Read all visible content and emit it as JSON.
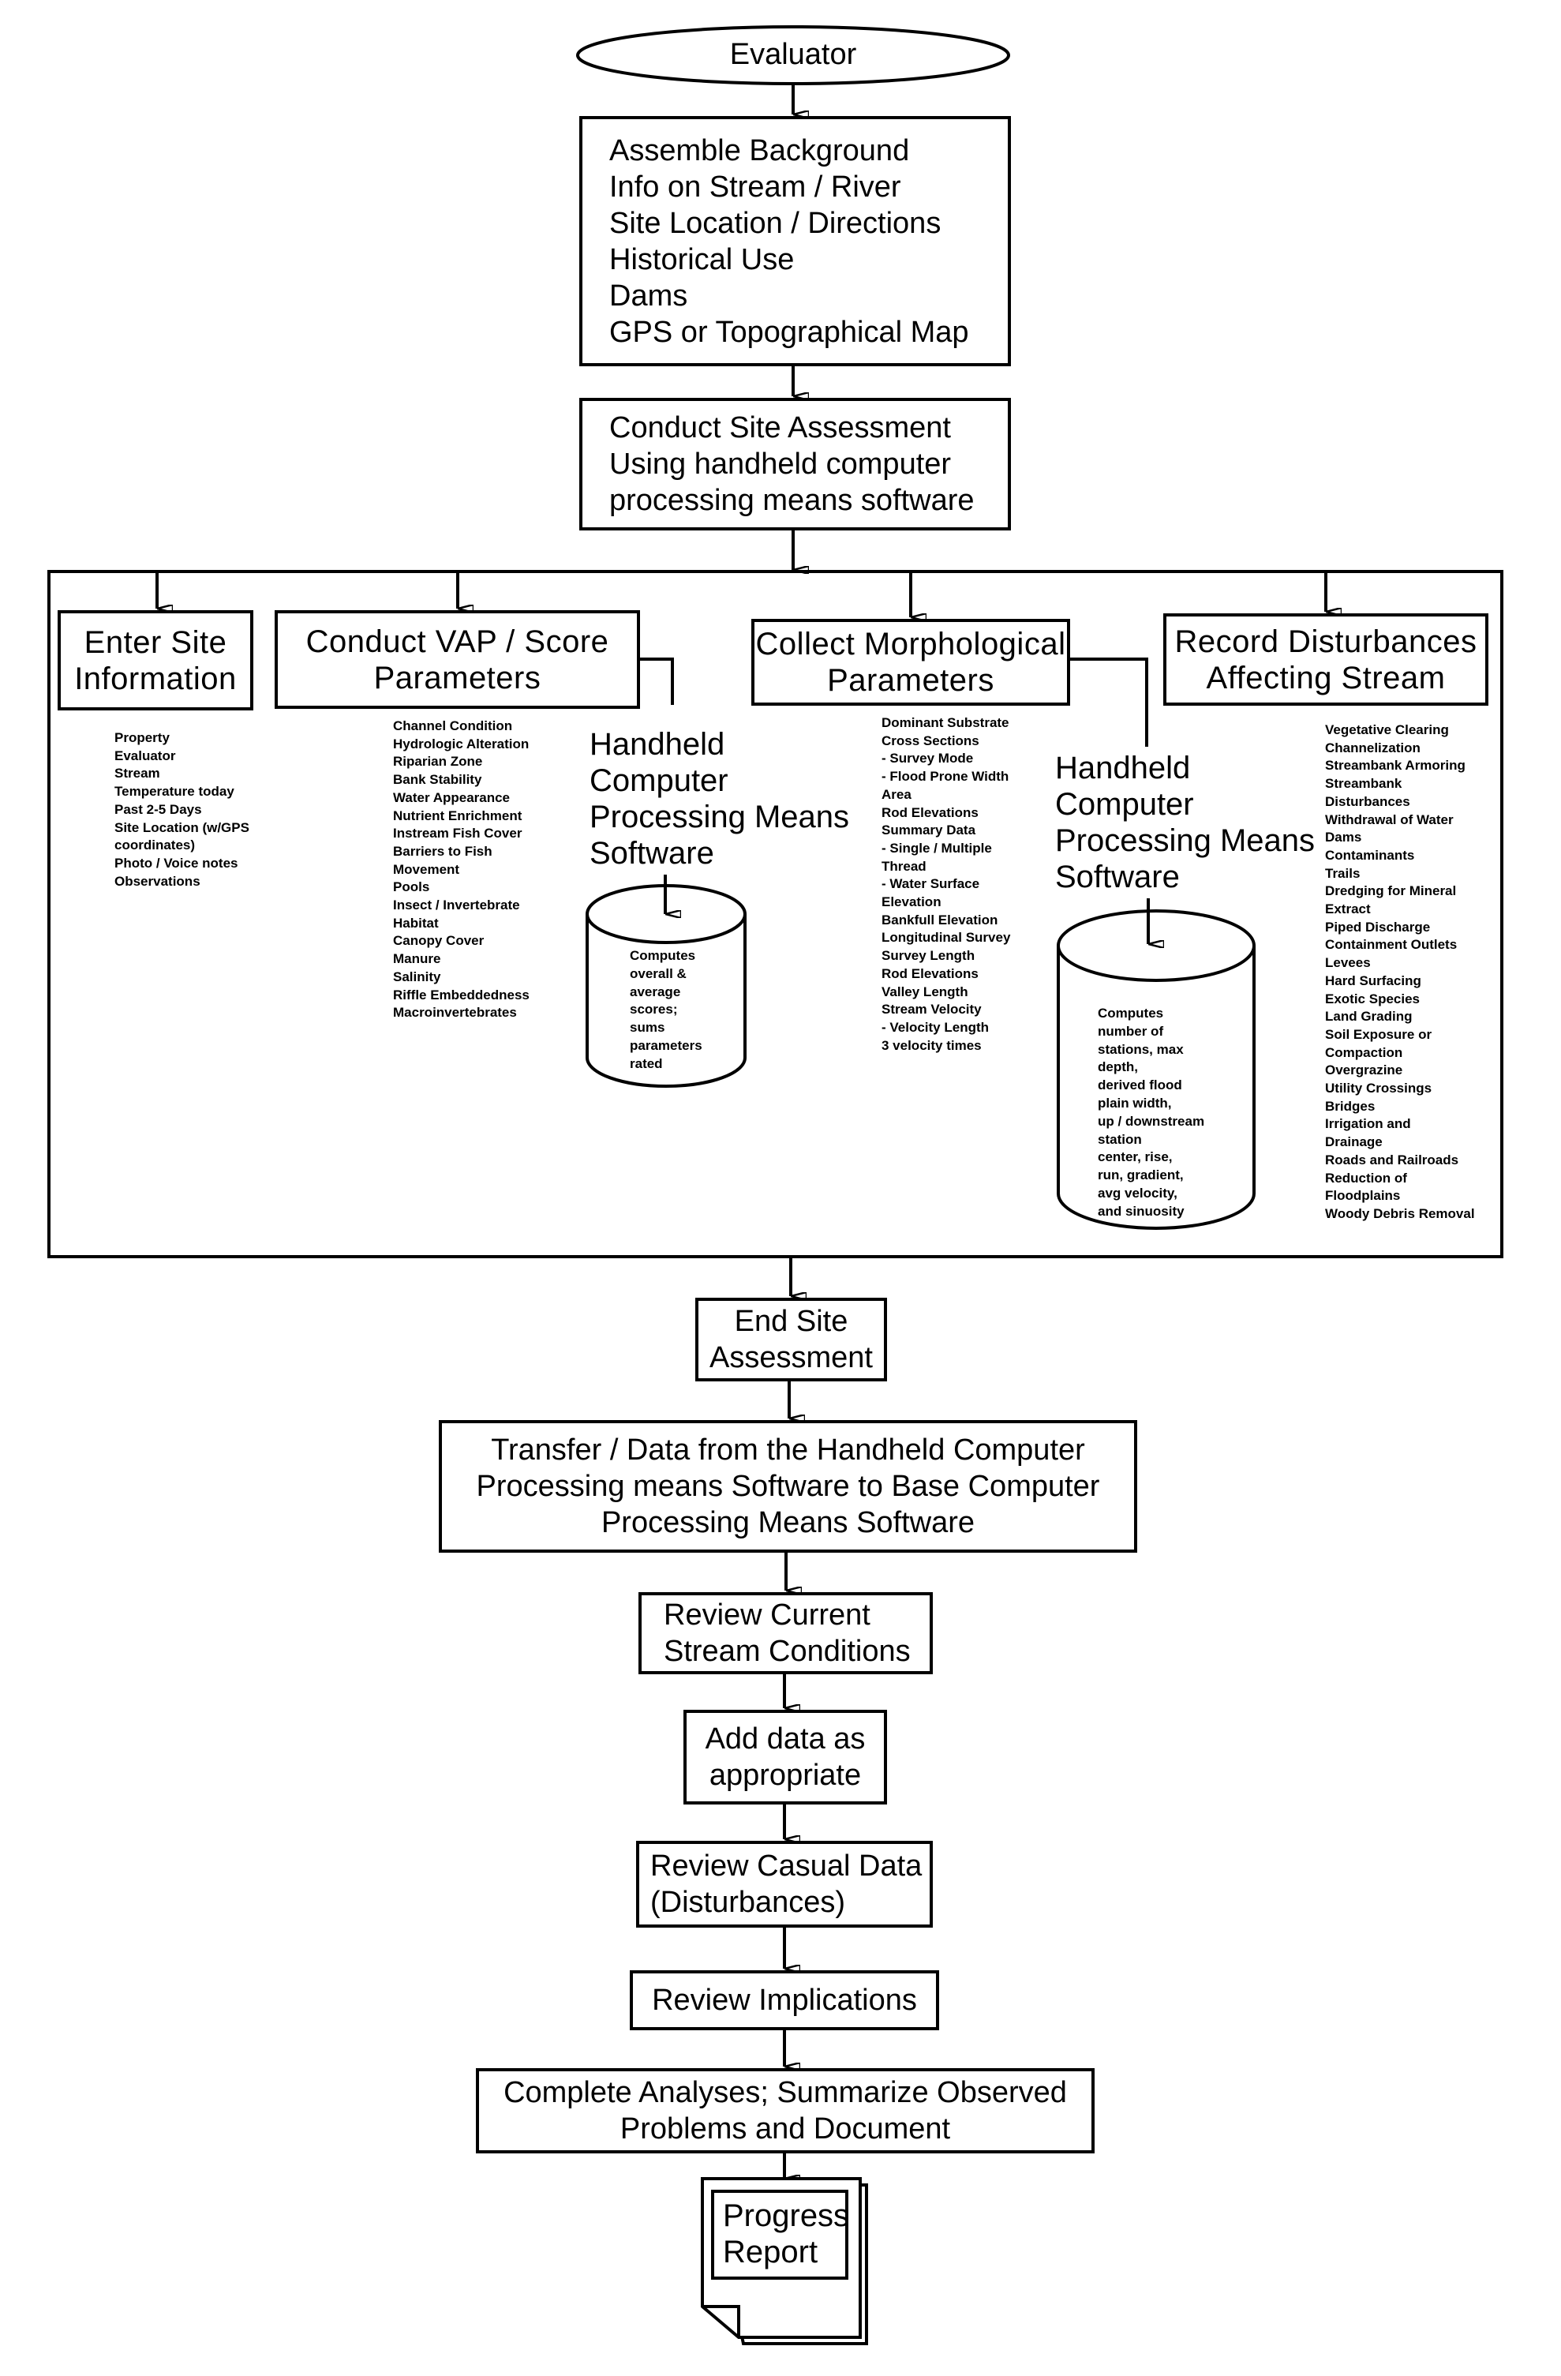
{
  "flowchart": {
    "start": {
      "label": "Evaluator"
    },
    "assemble": {
      "lines": [
        "Assemble Background",
        "Info on Stream / River",
        "Site Location / Directions",
        "Historical Use",
        "Dams",
        "GPS or Topographical Map"
      ]
    },
    "conduct": {
      "lines": [
        "Conduct Site Assessment",
        "Using handheld computer",
        "processing means software"
      ]
    },
    "site_assessment_group": {
      "enter_site": {
        "title": [
          "Enter Site",
          "Information"
        ],
        "items": [
          "Property",
          "Evaluator",
          "Stream",
          "Temperature today",
          "Past 2-5 Days",
          "Site Location (w/GPS",
          "coordinates)",
          "Photo / Voice notes",
          "Observations"
        ]
      },
      "vap": {
        "title": [
          "Conduct VAP / Score",
          "Parameters"
        ],
        "items": [
          "Channel Condition",
          "Hydrologic Alteration",
          "Riparian Zone",
          "Bank Stability",
          "Water Appearance",
          "Nutrient Enrichment",
          "Instream Fish Cover",
          "Barriers to Fish",
          "Movement",
          "Pools",
          "Insect / Invertebrate",
          "Habitat",
          "Canopy Cover",
          "Manure",
          "Salinity",
          "Riffle Embeddedness",
          "Macroinvertebrates"
        ],
        "software_label": [
          "Handheld",
          "Computer",
          "Processing Means",
          "Software"
        ],
        "database_text": [
          "Computes",
          "overall &",
          "average",
          "scores;",
          "sums",
          "parameters",
          "rated"
        ]
      },
      "morph": {
        "title": [
          "Collect Morphological",
          "Parameters"
        ],
        "items": [
          "Dominant Substrate",
          "Cross Sections",
          "- Survey Mode",
          "- Flood Prone Width",
          "Area",
          "Rod Elevations",
          "Summary Data",
          "- Single / Multiple",
          "Thread",
          "- Water Surface",
          "Elevation",
          "Bankfull Elevation",
          "Longitudinal Survey",
          "Survey Length",
          "Rod Elevations",
          "Valley Length",
          "Stream Velocity",
          "- Velocity Length",
          "3 velocity times"
        ],
        "software_label": [
          "Handheld",
          "Computer",
          "Processing Means",
          "Software"
        ],
        "database_text": [
          "Computes",
          "number of",
          "stations, max",
          "depth,",
          "derived flood",
          "plain width,",
          "up / downstream",
          "station",
          "center, rise,",
          "run, gradient,",
          "avg velocity,",
          "and sinuosity"
        ]
      },
      "disturb": {
        "title": [
          "Record Disturbances",
          "Affecting Stream"
        ],
        "items": [
          "Vegetative Clearing",
          "Channelization",
          "Streambank Armoring",
          "Streambank",
          "Disturbances",
          "Withdrawal of Water",
          "Dams",
          "Contaminants",
          "Trails",
          "Dredging for Mineral",
          "Extract",
          "Piped Discharge",
          "Containment Outlets",
          "Levees",
          "Hard Surfacing",
          "Exotic Species",
          "Land Grading",
          "Soil Exposure or",
          "Compaction",
          "Overgrazine",
          "Utility Crossings",
          "Bridges",
          "Irrigation and",
          "Drainage",
          "Roads and Railroads",
          "Reduction of",
          "Floodplains",
          "Woody Debris Removal"
        ]
      }
    },
    "end_assessment": {
      "lines": [
        "End Site",
        "Assessment"
      ]
    },
    "transfer": {
      "lines": [
        "Transfer / Data from the Handheld Computer",
        "Processing means Software to Base Computer",
        "Processing Means Software"
      ]
    },
    "review_current": {
      "lines": [
        "Review Current",
        "Stream Conditions"
      ]
    },
    "add_data": {
      "lines": [
        "Add data as",
        "appropriate"
      ]
    },
    "review_casual": {
      "lines": [
        "Review Casual Data",
        "(Disturbances)"
      ]
    },
    "review_implications": {
      "lines": [
        "Review Implications"
      ]
    },
    "complete": {
      "lines": [
        "Complete Analyses; Summarize Observed",
        "Problems and Document"
      ]
    },
    "report": {
      "lines": [
        "Progress",
        "Report"
      ]
    }
  }
}
